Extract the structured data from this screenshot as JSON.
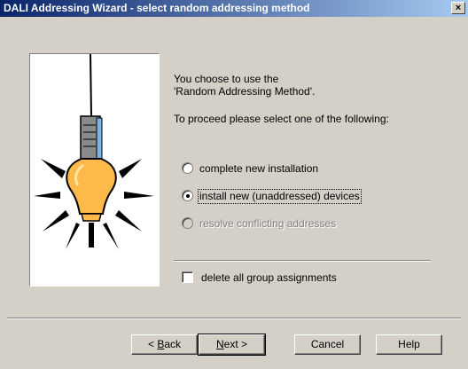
{
  "window": {
    "title": "DALI Addressing Wizard - select random addressing method",
    "close_glyph": "×"
  },
  "intro": {
    "line1": "You choose to use the",
    "line2": "'Random Addressing Method'.",
    "line3": "To proceed please select one of the following:"
  },
  "options": [
    {
      "label": "complete new installation",
      "checked": false,
      "enabled": true
    },
    {
      "label": "install new (unaddressed) devices",
      "checked": true,
      "enabled": true
    },
    {
      "label": "resolve conflicting addresses",
      "checked": false,
      "enabled": false
    }
  ],
  "checkbox": {
    "label": "delete all group assignments",
    "checked": false
  },
  "buttons": {
    "back_prefix": "< ",
    "back_accel": "B",
    "back_rest": "ack",
    "next_accel": "N",
    "next_rest": "ext >",
    "cancel": "Cancel",
    "help": "Help"
  },
  "image_icon": "light-bulb-icon"
}
